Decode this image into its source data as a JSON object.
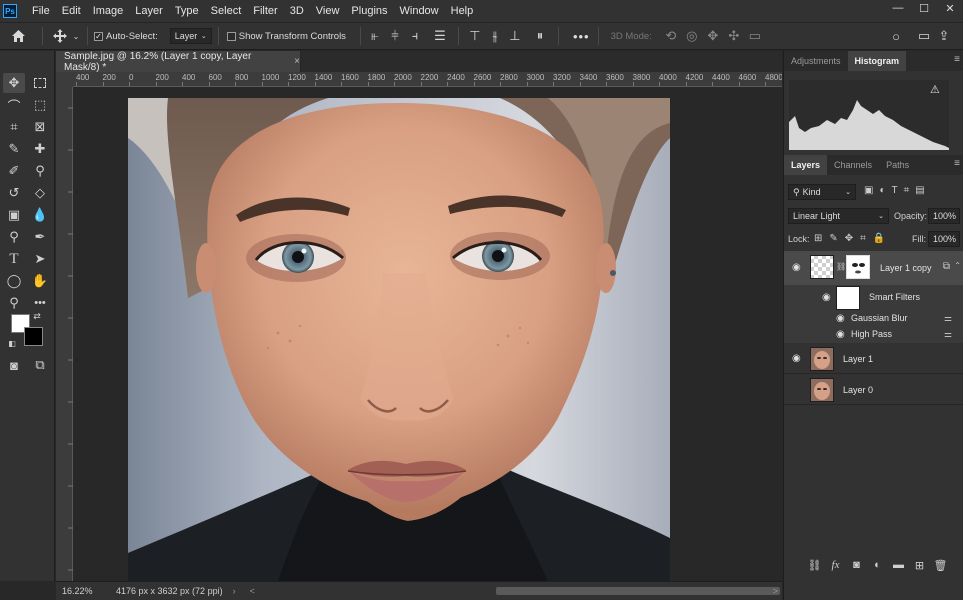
{
  "app": {
    "logo": "Ps"
  },
  "menu": [
    "File",
    "Edit",
    "Image",
    "Layer",
    "Type",
    "Select",
    "Filter",
    "3D",
    "View",
    "Plugins",
    "Window",
    "Help"
  ],
  "window_controls": {
    "minimize": "—",
    "maximize": "☐",
    "close": "✕"
  },
  "options_bar": {
    "home_icon": "home-icon",
    "move_icon": "move-tool-icon",
    "auto_select_label": "Auto-Select:",
    "auto_select_checked": true,
    "auto_select_target": "Layer",
    "show_transform_label": "Show Transform Controls",
    "show_transform_checked": false,
    "mode_3d_label": "3D Mode:",
    "more_label": "•••"
  },
  "document": {
    "tab_title": "Sample.jpg @ 16.2% (Layer 1 copy, Layer Mask/8) *",
    "close_label": "×",
    "ruler_ticks": [
      "400",
      "200",
      "0",
      "200",
      "400",
      "600",
      "800",
      "1000",
      "1200",
      "1400",
      "1600",
      "1800",
      "2000",
      "2200",
      "2400",
      "2600",
      "2800",
      "3000",
      "3200",
      "3400",
      "3600",
      "3800",
      "4000",
      "4200",
      "4400",
      "4600",
      "4800"
    ],
    "photo_alt": "Close-up portrait of a woman with blue eyes wearing a black turtleneck"
  },
  "status": {
    "zoom": "16.22%",
    "doc_info": "4176 px x 3632 px (72 ppi)",
    "nav_left": "<",
    "nav_right": ">"
  },
  "panels": {
    "top_tabs": [
      "Adjustments",
      "Histogram"
    ],
    "top_active": "Histogram",
    "histogram_warning": "⚠",
    "layer_tabs": [
      "Layers",
      "Channels",
      "Paths"
    ],
    "layer_active": "Layers",
    "filter_kind": "Kind",
    "blend_mode": "Linear Light",
    "opacity_label": "Opacity:",
    "opacity_value": "100%",
    "lock_label": "Lock:",
    "fill_label": "Fill:",
    "fill_value": "100%",
    "layers": [
      {
        "name": "Layer 1 copy",
        "visible": true,
        "selected": true
      },
      {
        "name": "Smart Filters",
        "visible": true
      },
      {
        "name": "Gaussian Blur",
        "visible": true
      },
      {
        "name": "High Pass",
        "visible": true
      },
      {
        "name": "Layer 1",
        "visible": true
      },
      {
        "name": "Layer 0",
        "visible": false
      }
    ],
    "eye_glyph": "👁"
  },
  "colors": {
    "foreground": "#ffffff",
    "background": "#000000",
    "accent": "#31a8ff",
    "panel_bg": "#323232"
  }
}
